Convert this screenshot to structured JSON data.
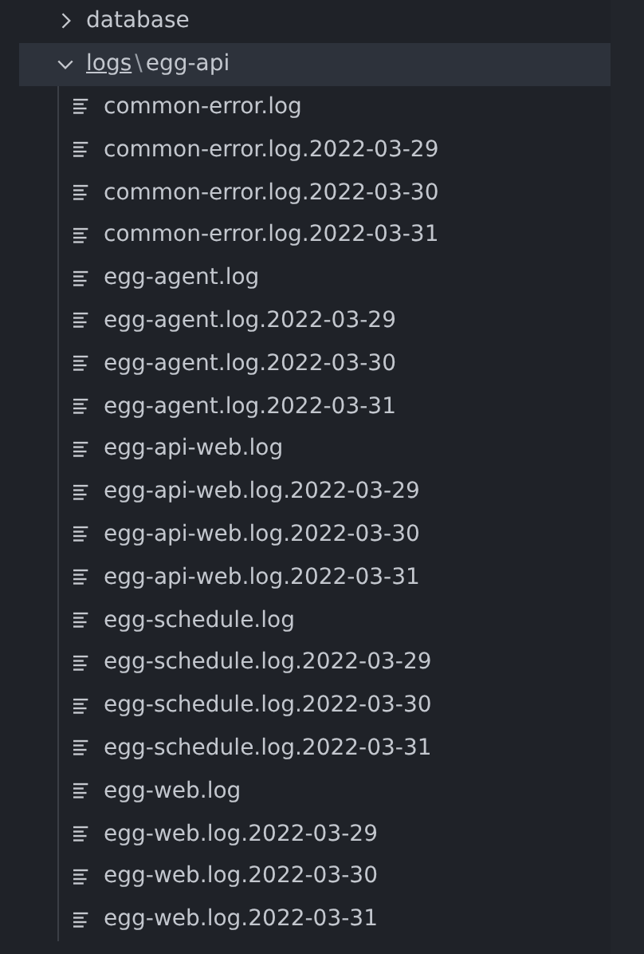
{
  "tree": [
    {
      "kind": "folder",
      "label": "database",
      "expanded": false,
      "selected": false
    },
    {
      "kind": "compact_folder",
      "parts": [
        "logs",
        "egg-api"
      ],
      "separator": "\\",
      "expanded": true,
      "selected": true,
      "children": [
        {
          "label": "common-error.log"
        },
        {
          "label": "common-error.log.2022-03-29"
        },
        {
          "label": "common-error.log.2022-03-30"
        },
        {
          "label": "common-error.log.2022-03-31"
        },
        {
          "label": "egg-agent.log"
        },
        {
          "label": "egg-agent.log.2022-03-29"
        },
        {
          "label": "egg-agent.log.2022-03-30"
        },
        {
          "label": "egg-agent.log.2022-03-31"
        },
        {
          "label": "egg-api-web.log"
        },
        {
          "label": "egg-api-web.log.2022-03-29"
        },
        {
          "label": "egg-api-web.log.2022-03-30"
        },
        {
          "label": "egg-api-web.log.2022-03-31"
        },
        {
          "label": "egg-schedule.log"
        },
        {
          "label": "egg-schedule.log.2022-03-29"
        },
        {
          "label": "egg-schedule.log.2022-03-30"
        },
        {
          "label": "egg-schedule.log.2022-03-31"
        },
        {
          "label": "egg-web.log"
        },
        {
          "label": "egg-web.log.2022-03-29"
        },
        {
          "label": "egg-web.log.2022-03-30"
        },
        {
          "label": "egg-web.log.2022-03-31"
        }
      ]
    }
  ]
}
